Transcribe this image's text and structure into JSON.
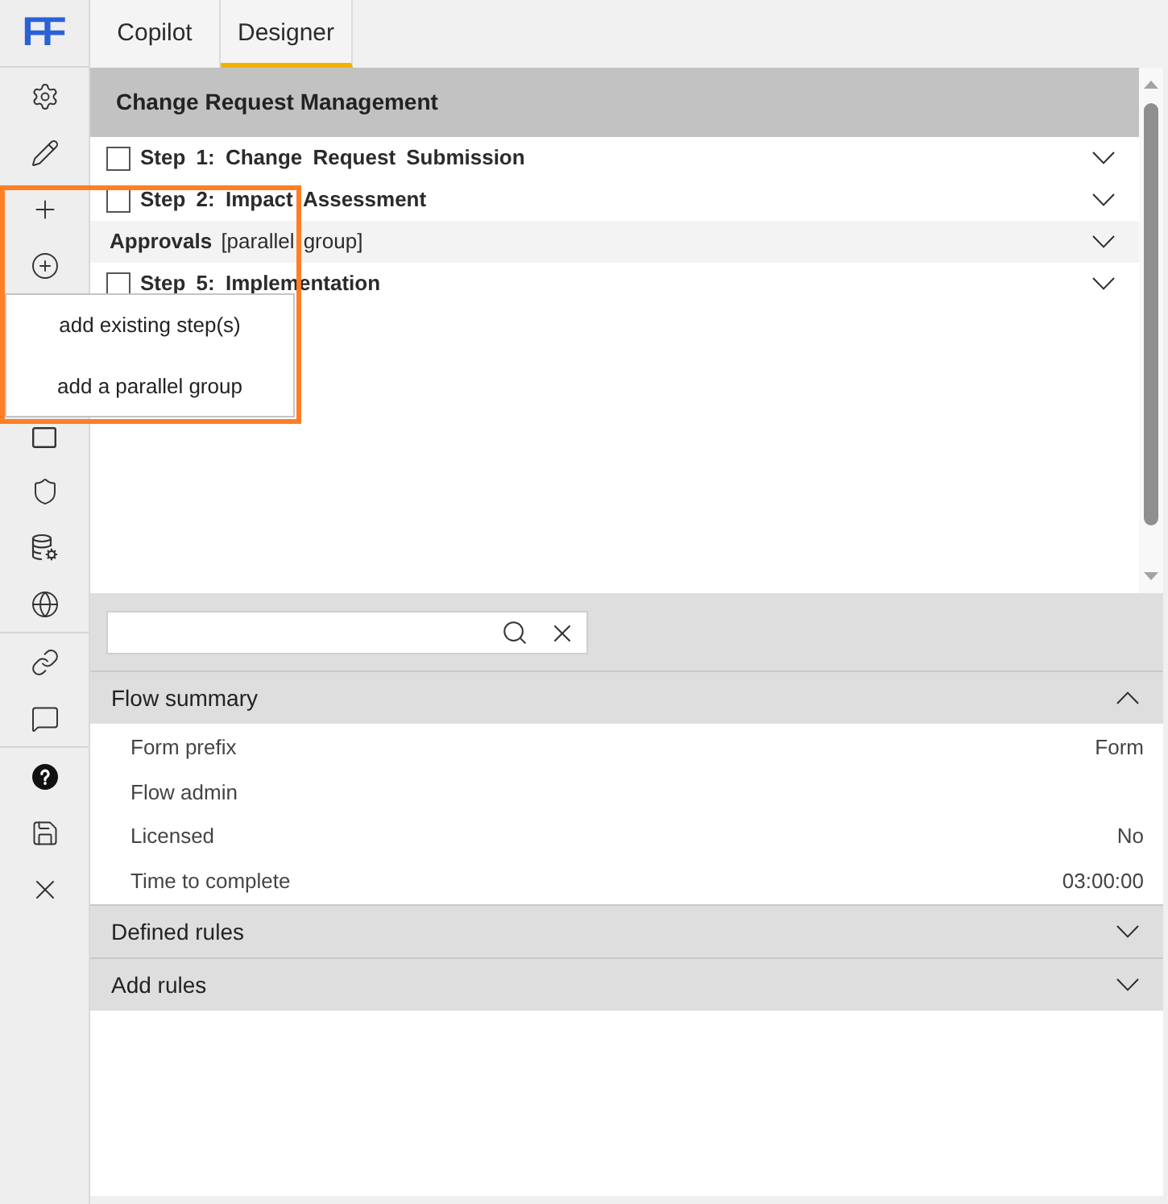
{
  "logo": "FF",
  "tabs": [
    {
      "label": "Copilot",
      "selected": false
    },
    {
      "label": "Designer",
      "selected": true
    }
  ],
  "flow": {
    "title": "Change Request Management",
    "steps": [
      {
        "kind": "step",
        "label": "Step 1: Change Request Submission",
        "checked": false,
        "expanded": false
      },
      {
        "kind": "step",
        "label": "Step 2: Impact Assessment",
        "checked": false,
        "expanded": false
      },
      {
        "kind": "group",
        "label": "**Approvals** [parallel group]",
        "expanded": false
      },
      {
        "kind": "step",
        "label": "Step 5: Implementation",
        "checked": false,
        "expanded": false
      }
    ]
  },
  "add_menu": {
    "items": [
      "add existing step(s)",
      "add a parallel group"
    ]
  },
  "sections": [
    {
      "title": "Flow summary",
      "expanded": true,
      "rows": [
        {
          "label": "Form prefix",
          "value": "Form"
        },
        {
          "label": "Flow admin"
        },
        {
          "label": "Licensed",
          "value": "No"
        },
        {
          "label": "Time to complete",
          "value": "03:00:00"
        }
      ]
    },
    {
      "title": "Defined rules",
      "expanded": false
    },
    {
      "title": "Add rules",
      "expanded": false
    }
  ]
}
